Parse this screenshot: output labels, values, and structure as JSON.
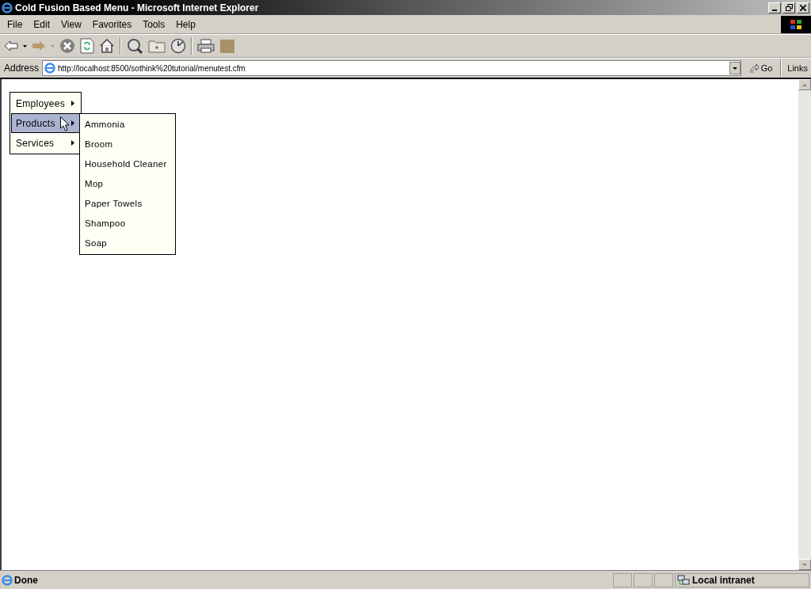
{
  "window": {
    "title": "Cold Fusion Based Menu - Microsoft Internet Explorer"
  },
  "menu_bar": [
    "File",
    "Edit",
    "View",
    "Favorites",
    "Tools",
    "Help"
  ],
  "address_bar": {
    "label": "Address",
    "value": "http://localhost:8500/sothink%20tutorial/menutest.cfm",
    "go": "Go",
    "links": "Links"
  },
  "menu": {
    "items": [
      {
        "label": "Employees",
        "selected": false
      },
      {
        "label": "Products",
        "selected": true
      },
      {
        "label": "Services",
        "selected": false
      }
    ],
    "submenu": [
      "Ammonia",
      "Broom",
      "Household Cleaner",
      "Mop",
      "Paper Towels",
      "Shampoo",
      "Soap"
    ]
  },
  "status_bar": {
    "text": "Done",
    "zone": "Local intranet"
  }
}
